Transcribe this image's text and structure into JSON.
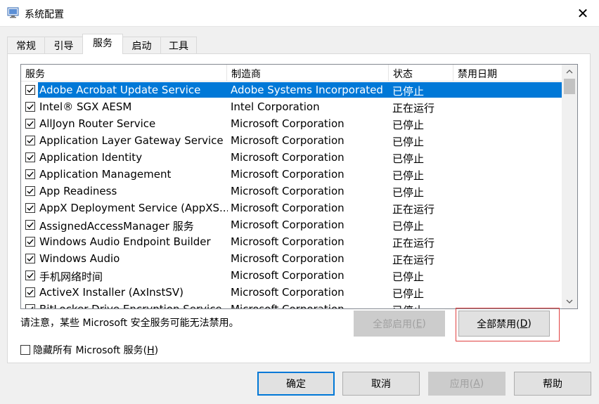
{
  "window": {
    "title": "系统配置",
    "close_glyph": "✕"
  },
  "tabs": [
    {
      "label": "常规",
      "active": false
    },
    {
      "label": "引导",
      "active": false
    },
    {
      "label": "服务",
      "active": true
    },
    {
      "label": "启动",
      "active": false
    },
    {
      "label": "工具",
      "active": false
    }
  ],
  "table": {
    "columns": [
      "服务",
      "制造商",
      "状态",
      "禁用日期"
    ],
    "rows": [
      {
        "checked": true,
        "service": "Adobe Acrobat Update Service",
        "vendor": "Adobe Systems Incorporated",
        "status": "已停止",
        "selected": true
      },
      {
        "checked": true,
        "service": "Intel® SGX AESM",
        "vendor": "Intel Corporation",
        "status": "正在运行"
      },
      {
        "checked": true,
        "service": "AllJoyn Router Service",
        "vendor": "Microsoft Corporation",
        "status": "已停止"
      },
      {
        "checked": true,
        "service": "Application Layer Gateway Service",
        "vendor": "Microsoft Corporation",
        "status": "已停止"
      },
      {
        "checked": true,
        "service": "Application Identity",
        "vendor": "Microsoft Corporation",
        "status": "已停止"
      },
      {
        "checked": true,
        "service": "Application Management",
        "vendor": "Microsoft Corporation",
        "status": "已停止"
      },
      {
        "checked": true,
        "service": "App Readiness",
        "vendor": "Microsoft Corporation",
        "status": "已停止"
      },
      {
        "checked": true,
        "service": "AppX Deployment Service (AppXS...",
        "vendor": "Microsoft Corporation",
        "status": "正在运行"
      },
      {
        "checked": true,
        "service": "AssignedAccessManager 服务",
        "vendor": "Microsoft Corporation",
        "status": "已停止"
      },
      {
        "checked": true,
        "service": "Windows Audio Endpoint Builder",
        "vendor": "Microsoft Corporation",
        "status": "正在运行"
      },
      {
        "checked": true,
        "service": "Windows Audio",
        "vendor": "Microsoft Corporation",
        "status": "正在运行"
      },
      {
        "checked": true,
        "service": "手机网络时间",
        "vendor": "Microsoft Corporation",
        "status": "已停止"
      },
      {
        "checked": true,
        "service": "ActiveX Installer (AxInstSV)",
        "vendor": "Microsoft Corporation",
        "status": "已停止"
      },
      {
        "checked": true,
        "service": "BitLocker Drive Encryption Service",
        "vendor": "Microsoft Corporation",
        "status": "已停止"
      }
    ]
  },
  "note": "请注意，某些 Microsoft 安全服务可能无法禁用。",
  "buttons": {
    "enable_all": {
      "pre": "全部启用(",
      "key": "E",
      "post": ")"
    },
    "disable_all": {
      "pre": "全部禁用(",
      "key": "D",
      "post": ")"
    },
    "ok": "确定",
    "cancel": "取消",
    "apply": {
      "pre": "应用(",
      "key": "A",
      "post": ")"
    },
    "help": "帮助"
  },
  "hide_ms": {
    "pre": "隐藏所有 Microsoft 服务(",
    "key": "H",
    "post": ")",
    "checked": false
  },
  "colors": {
    "selection": "#0078d7",
    "highlight_box": "#e04040"
  }
}
